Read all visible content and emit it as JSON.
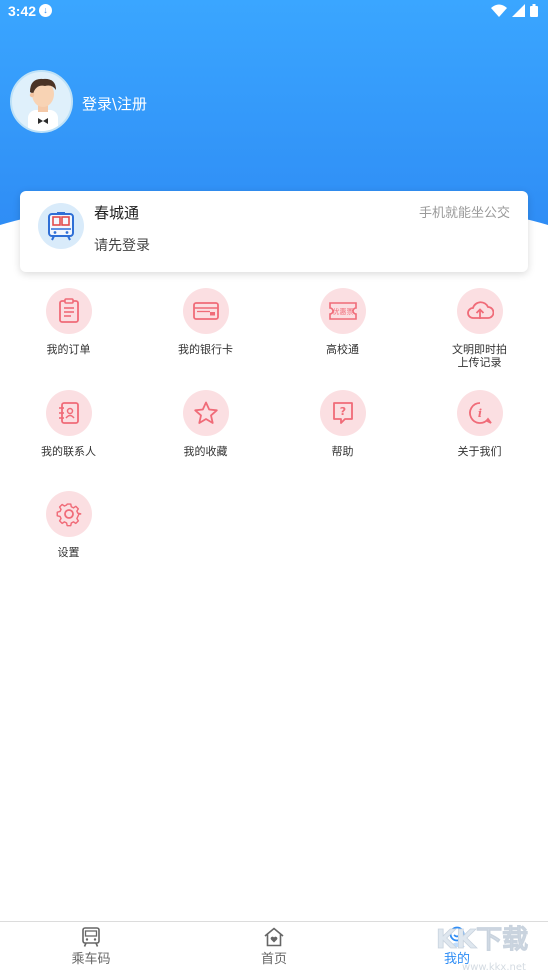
{
  "status_bar": {
    "time": "3:42"
  },
  "profile": {
    "login_label": "登录\\注册"
  },
  "card": {
    "title": "春城通",
    "slogan": "手机就能坐公交",
    "subtitle": "请先登录"
  },
  "menu": {
    "items": [
      {
        "label": "我的订单",
        "icon": "order-icon"
      },
      {
        "label": "我的银行卡",
        "icon": "bank-card-icon"
      },
      {
        "label": "高校通",
        "icon": "coupon-icon",
        "badge": "优惠票"
      },
      {
        "label": "文明即时拍",
        "label2": "上传记录",
        "icon": "cloud-upload-icon"
      },
      {
        "label": "我的联系人",
        "icon": "contacts-icon"
      },
      {
        "label": "我的收藏",
        "icon": "star-icon"
      },
      {
        "label": "帮助",
        "icon": "help-icon"
      },
      {
        "label": "关于我们",
        "icon": "info-icon"
      },
      {
        "label": "设置",
        "icon": "gear-icon"
      }
    ]
  },
  "tabbar": {
    "tabs": [
      {
        "label": "乘车码",
        "icon": "bus-icon"
      },
      {
        "label": "首页",
        "icon": "home-icon"
      },
      {
        "label": "我的",
        "icon": "profile-icon"
      }
    ],
    "active_color": "#2f8df5"
  },
  "watermark": {
    "text": "KK下载",
    "url": "www.kkx.net"
  },
  "colors": {
    "header": "#2f8df5",
    "icon_bg": "#fbdfe2",
    "icon_stroke": "#f06b78"
  }
}
